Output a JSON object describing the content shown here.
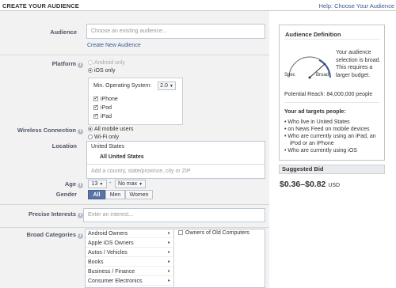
{
  "header": {
    "title": "CREATE YOUR AUDIENCE",
    "help_label": "Help: Choose Your Audience"
  },
  "audience": {
    "label": "Audience",
    "placeholder": "Choose an existing audience...",
    "create_link": "Create New Audience"
  },
  "platform": {
    "label": "Platform",
    "options": [
      "Android only",
      "iOS only"
    ],
    "selected": "iOS only",
    "min_os_label": "Min. Operating System:",
    "min_os_value": "2.0",
    "devices": [
      "iPhone",
      "iPod",
      "iPad"
    ]
  },
  "wireless": {
    "label": "Wireless Connection",
    "options": [
      "All mobile users",
      "Wi-Fi only"
    ],
    "selected": "All mobile users"
  },
  "location": {
    "label": "Location",
    "country": "United States",
    "scope": "All United States",
    "placeholder": "Add a country, state/province, city or ZIP"
  },
  "age": {
    "label": "Age",
    "min": "13",
    "dash": "-",
    "max": "No max"
  },
  "gender": {
    "label": "Gender",
    "options": [
      "All",
      "Men",
      "Women"
    ],
    "selected": "All"
  },
  "interests": {
    "label": "Precise Interests",
    "placeholder": "Enter an interest..."
  },
  "broad_categories": {
    "label": "Broad Categories",
    "items": [
      "Android Owners",
      "Apple iOS Owners",
      "Autos / Vehicles",
      "Books",
      "Business / Finance",
      "Consumer Electronics"
    ],
    "selected_items": [
      "Owners of Old Computers"
    ]
  },
  "sidebar": {
    "title": "Audience Definition",
    "meter_left": "Spec",
    "meter_right": "Broad",
    "description": "Your audience selection is broad. This requires a larger budget.",
    "reach_label": "Potential Reach:",
    "reach_value": "84,000,000 people",
    "targets_title": "Your ad targets people:",
    "targets": [
      "Who live in United States",
      "on News Feed on mobile devices",
      "Who are currently using an iPad, an iPod or an iPhone",
      "Who are currently using iOS"
    ]
  },
  "bid": {
    "label": "Suggested Bid",
    "range": "$0.36–$0.82",
    "currency": "USD"
  },
  "colors": {
    "link": "#3b5998",
    "button_selected": "#5b74a8",
    "form_bg": "#f2f2f2"
  }
}
